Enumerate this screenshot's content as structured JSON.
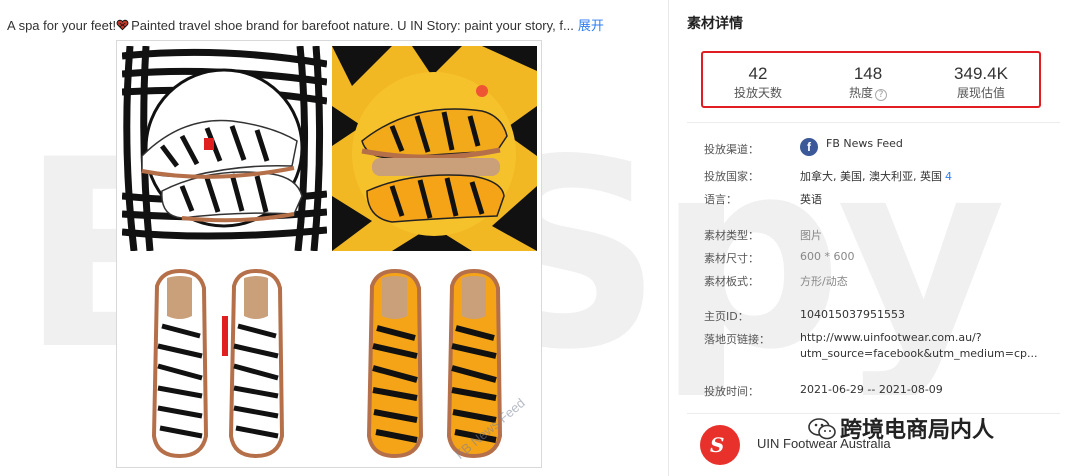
{
  "watermark": "BigSpy",
  "ad": {
    "description": "A spa for your feet!",
    "description_rest": "Painted travel shoe brand for barefoot nature. U IN Story: paint your story, f...",
    "expand_label": "展开",
    "preview_overlay": "FB News Feed"
  },
  "details": {
    "title": "素材详情",
    "stats": [
      {
        "value": "42",
        "label": "投放天数"
      },
      {
        "value": "148",
        "label": "热度"
      },
      {
        "value": "349.4K",
        "label": "展现估值"
      }
    ],
    "rows": {
      "channel": {
        "key": "投放渠道：",
        "value": "FB News Feed"
      },
      "countries": {
        "key": "投放国家：",
        "value": "加拿大, 美国, 澳大利亚, 英国",
        "more": "4"
      },
      "language": {
        "key": "语言：",
        "value": "英语"
      },
      "type": {
        "key": "素材类型：",
        "value": "图片"
      },
      "size": {
        "key": "素材尺寸：",
        "value": "600 * 600"
      },
      "format": {
        "key": "素材板式：",
        "value": "方形/动态"
      },
      "page_id": {
        "key": "主页ID：",
        "value": "104015037951553"
      },
      "landing": {
        "key": "落地页链接：",
        "value_line1": "http://www.uinfootwear.com.au/?",
        "value_line2": "utm_source=facebook&utm_medium=cp..."
      },
      "time": {
        "key": "投放时间：",
        "value": "2021-06-29 -- 2021-08-09"
      }
    },
    "advertiser": {
      "name": "UIN Footwear Australia"
    }
  },
  "footer_watermark": "跨境电商局内人",
  "colors": {
    "highlight_border": "#e21c23",
    "link": "#2f7ef0",
    "facebook": "#3b5998",
    "brand": "#e8312b"
  }
}
